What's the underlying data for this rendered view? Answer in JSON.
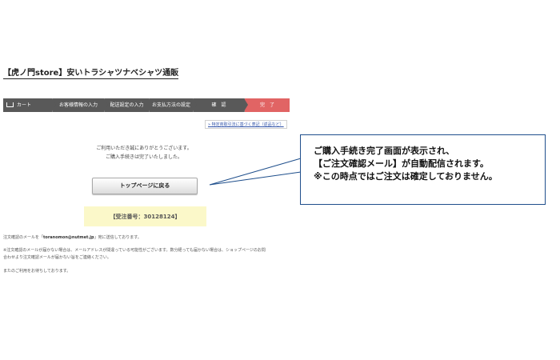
{
  "store": {
    "title": "【虎ノ門store】安いトラシャツナベシャツ通販"
  },
  "steps": [
    {
      "label": "カート",
      "icon": "cart-icon"
    },
    {
      "label": "お客様情報の入力"
    },
    {
      "label": "配送設定の入力"
    },
    {
      "label": "お支払方法の設定"
    },
    {
      "label": "確　認"
    },
    {
      "label": "完　了",
      "active": true
    }
  ],
  "colors": {
    "step_bg": "#595959",
    "step_active": "#e16464",
    "order_bg": "#fbf8c9",
    "callout_border": "#1f4f8c"
  },
  "terms_link": "» 特定商取引法に基づく表記（返品など）",
  "thanks": {
    "line1": "ご利用いただき誠にありがとうございます。",
    "line2": "ご購入手続きは完了いたしました。"
  },
  "top_button": "トップページに戻る",
  "order": {
    "label": "【受注番号：30128124】"
  },
  "info": {
    "p1_prefix": "注文確認のメールを「",
    "p1_email": "toranomon@nutmet.jp",
    "p1_suffix": "」宛に送信しております。",
    "p2": "※注文確認のメールが届かない場合は、メールアドレスが間違っている可能性がございます。数分経っても届かない場合は、ショップページのお問",
    "p3": "合わせより注文確認メールが届かない旨をご連絡ください。",
    "p4": "またのご利用をお待ちしております。"
  },
  "callout": {
    "line1": "ご購入手続き完了画面が表示され、",
    "line2": "【ご注文確認メール】が自動配信されます。",
    "line3": "※この時点ではご注文は確定しておりません。"
  }
}
